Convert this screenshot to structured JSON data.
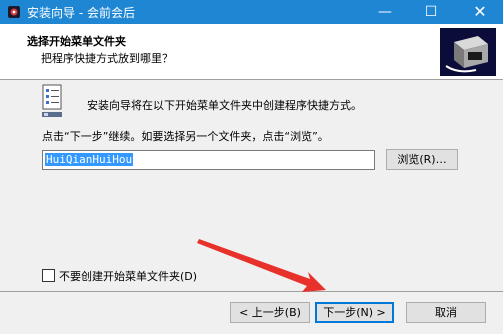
{
  "window": {
    "title": "安装向导 - 会前会后",
    "minimize_glyph": "—",
    "maximize_glyph": "☐",
    "close_glyph": "✕"
  },
  "header": {
    "title": "选择开始菜单文件夹",
    "subtitle": "把程序快捷方式放到哪里？"
  },
  "body": {
    "intro": "安装向导将在以下开始菜单文件夹中创建程序快捷方式。",
    "instruction": "点击“下一步”继续。如要选择另一个文件夹，点击“浏览”。",
    "folder_value": "HuiQianHuiHou",
    "browse_label": "浏览(R)…",
    "no_folder_label": "不要创建开始菜单文件夹(D)",
    "no_folder_checked": false
  },
  "footer": {
    "back_label": "< 上一步(B)",
    "next_label": "下一步(N) >",
    "cancel_label": "取消"
  },
  "colors": {
    "titlebar": "#1f86d3",
    "selection": "#3399ff",
    "annotation_arrow": "#e8312b",
    "default_button_border": "#0078d7"
  },
  "icons": {
    "app": "installer-app-icon",
    "header": "computer-box-icon",
    "folder": "start-menu-folder-icon"
  }
}
